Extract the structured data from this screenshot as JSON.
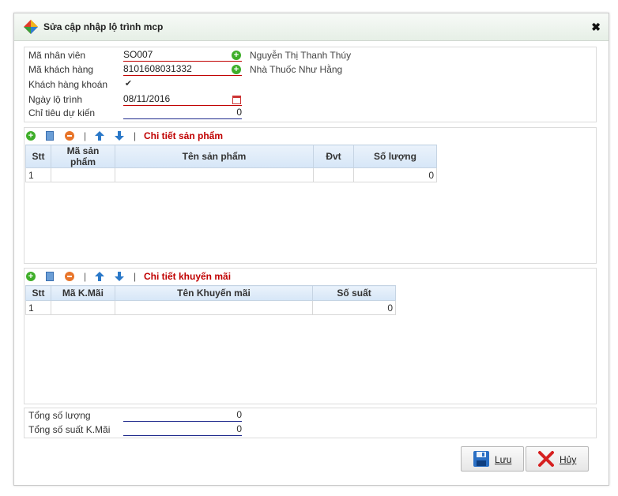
{
  "dialog": {
    "title": "Sửa cập nhập lộ trình mcp",
    "close_label": "✖"
  },
  "form": {
    "employee": {
      "label": "Mã nhân viên",
      "value": "SO007",
      "name": "Nguyễn Thị Thanh Thúy"
    },
    "customer": {
      "label": "Mã khách hàng",
      "value": "8101608031332",
      "name": "Nhà Thuốc Như Hằng"
    },
    "contract_customer": {
      "label": "Khách hàng khoán",
      "checked": true,
      "check_glyph": "✔"
    },
    "route_date": {
      "label": "Ngày lộ trình",
      "value": "08/11/2016"
    },
    "target": {
      "label": "Chỉ tiêu dự kiến",
      "value": "0"
    }
  },
  "toolbar": {
    "plus_glyph": "+",
    "separator": "|"
  },
  "products": {
    "title": "Chi tiết sản phẩm",
    "columns": [
      "Stt",
      "Mã sản phẩm",
      "Tên sản phẩm",
      "Đvt",
      "Số lượng"
    ],
    "rows": [
      {
        "stt": "1",
        "code": "",
        "name": "",
        "unit": "",
        "qty": "0"
      }
    ]
  },
  "promotions": {
    "title": "Chi tiết khuyến mãi",
    "columns": [
      "Stt",
      "Mã K.Mãi",
      "Tên Khuyến mãi",
      "Số suất"
    ],
    "rows": [
      {
        "stt": "1",
        "code": "",
        "name": "",
        "qty": "0"
      }
    ]
  },
  "totals": {
    "quantity": {
      "label": "Tổng số lượng",
      "value": "0"
    },
    "promo": {
      "label": "Tổng số suất K.Mãi",
      "value": "0"
    }
  },
  "buttons": {
    "save": "Lưu",
    "cancel": "Hủy"
  },
  "colors": {
    "required_underline": "#c00000",
    "normal_underline": "#1f2a8c",
    "section_title": "#c00000",
    "add_icon": "#3fae2a",
    "remove_icon": "#e8752a",
    "arrow_icon": "#2a78c8",
    "save_icon": "#2a6fc4",
    "cancel_icon": "#d62020"
  }
}
